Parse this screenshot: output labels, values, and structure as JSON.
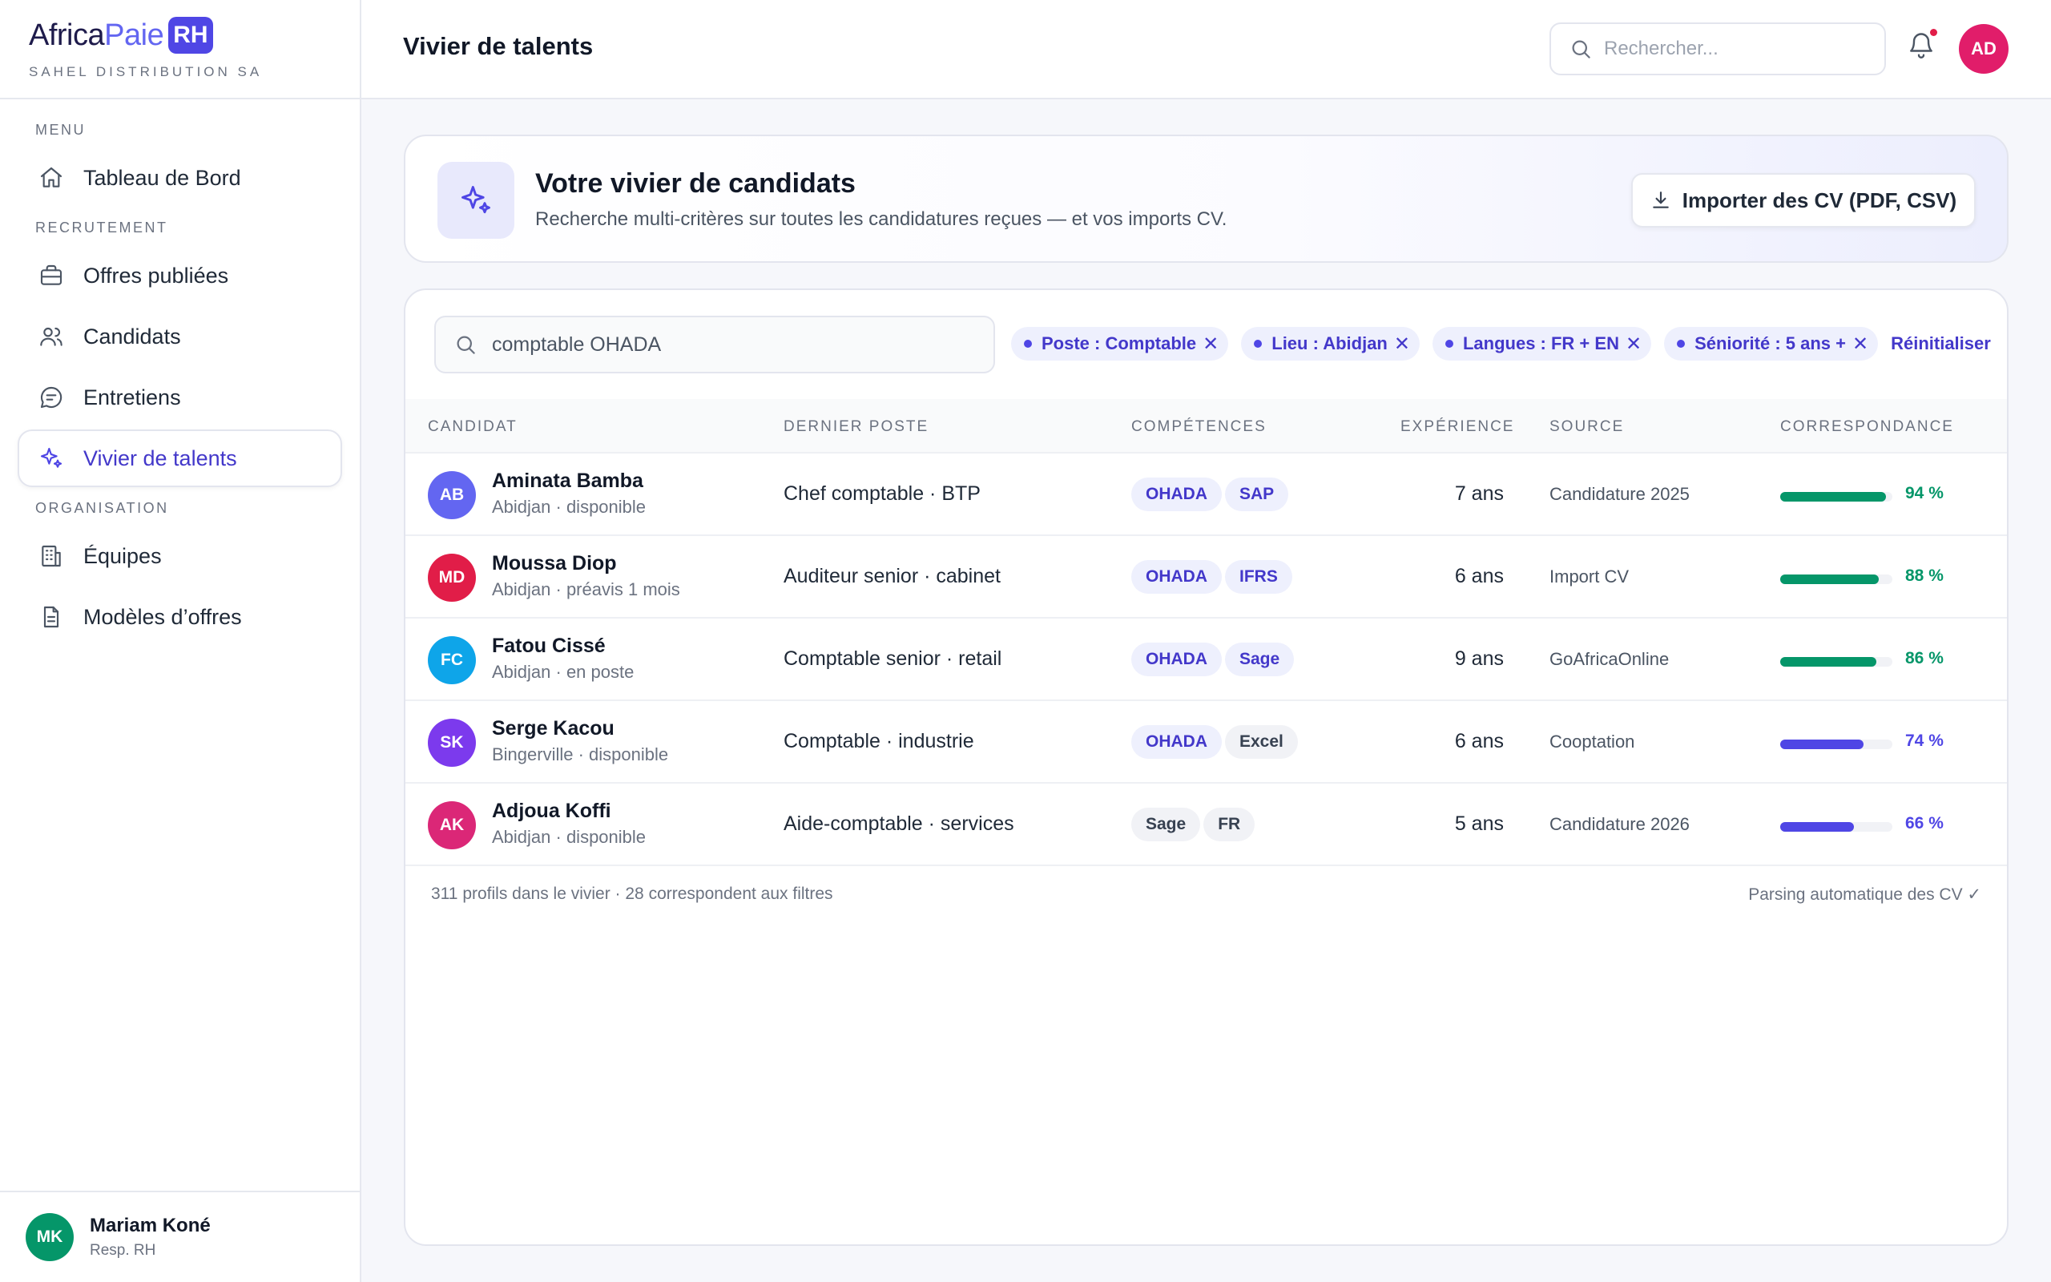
{
  "brand": {
    "logo_part1": "Africa",
    "logo_part2": "Paie",
    "logo_badge": "RH",
    "company": "SAHEL DISTRIBUTION SA"
  },
  "sidebar": {
    "sections": {
      "menu": "MENU",
      "recrutement": "RECRUTEMENT",
      "organisation": "ORGANISATION"
    },
    "items": [
      {
        "label": "Tableau de Bord",
        "icon": "home-icon"
      },
      {
        "label": "Offres publiées",
        "icon": "briefcase-icon"
      },
      {
        "label": "Candidats",
        "icon": "users-icon"
      },
      {
        "label": "Entretiens",
        "icon": "chat-icon"
      },
      {
        "label": "Vivier de talents",
        "icon": "sparkles-icon",
        "active": true
      },
      {
        "label": "Équipes",
        "icon": "building-icon"
      },
      {
        "label": "Modèles d’offres",
        "icon": "document-icon"
      }
    ],
    "user": {
      "initials": "MK",
      "name": "Mariam Koné",
      "role": "Resp. RH"
    }
  },
  "topbar": {
    "title": "Vivier de talents",
    "search_placeholder": "Rechercher...",
    "avatar_initials": "AD"
  },
  "hero": {
    "title": "Votre vivier de candidats",
    "subtitle": "Recherche multi-critères sur toutes les candidatures reçues — et vos imports CV.",
    "import_button": "Importer des CV (PDF, CSV)"
  },
  "filters": {
    "search_value": "comptable OHADA",
    "chips": [
      "Poste : Comptable",
      "Lieu : Abidjan",
      "Langues : FR + EN",
      "Séniorité : 5 ans +"
    ],
    "reset_label": "Réinitialiser"
  },
  "table": {
    "headers": {
      "candidat": "CANDIDAT",
      "poste": "DERNIER POSTE",
      "competences": "COMPÉTENCES",
      "experience": "EXPÉRIENCE",
      "source": "SOURCE",
      "correspondance": "CORRESPONDANCE"
    },
    "rows": [
      {
        "initials": "AB",
        "avatar_color": "#6366f1",
        "name": "Aminata Bamba",
        "sub": "Abidjan · disponible",
        "poste": "Chef comptable · BTP",
        "skills": [
          "OHADA",
          "SAP"
        ],
        "skill_style": [
          "hi",
          "hi"
        ],
        "experience": "7 ans",
        "source": "Candidature 2025",
        "match": 94,
        "match_label": "94 %",
        "match_color": "#059669"
      },
      {
        "initials": "MD",
        "avatar_color": "#e11d48",
        "name": "Moussa Diop",
        "sub": "Abidjan · préavis 1 mois",
        "poste": "Auditeur senior · cabinet",
        "skills": [
          "OHADA",
          "IFRS"
        ],
        "skill_style": [
          "hi",
          "hi"
        ],
        "experience": "6 ans",
        "source": "Import CV",
        "match": 88,
        "match_label": "88 %",
        "match_color": "#059669"
      },
      {
        "initials": "FC",
        "avatar_color": "#0ea5e9",
        "name": "Fatou Cissé",
        "sub": "Abidjan · en poste",
        "poste": "Comptable senior · retail",
        "skills": [
          "OHADA",
          "Sage"
        ],
        "skill_style": [
          "hi",
          "hi"
        ],
        "experience": "9 ans",
        "source": "GoAfricaOnline",
        "match": 86,
        "match_label": "86 %",
        "match_color": "#059669"
      },
      {
        "initials": "SK",
        "avatar_color": "#7c3aed",
        "name": "Serge Kacou",
        "sub": "Bingerville · disponible",
        "poste": "Comptable · industrie",
        "skills": [
          "OHADA",
          "Excel"
        ],
        "skill_style": [
          "hi",
          "lo"
        ],
        "experience": "6 ans",
        "source": "Cooptation",
        "match": 74,
        "match_label": "74 %",
        "match_color": "#4f46e5"
      },
      {
        "initials": "AK",
        "avatar_color": "#db2777",
        "name": "Adjoua Koffi",
        "sub": "Abidjan · disponible",
        "poste": "Aide-comptable · services",
        "skills": [
          "Sage",
          "FR"
        ],
        "skill_style": [
          "lo",
          "lo"
        ],
        "experience": "5 ans",
        "source": "Candidature 2026",
        "match": 66,
        "match_label": "66 %",
        "match_color": "#4f46e5"
      }
    ]
  },
  "footer": {
    "left": "311 profils dans le vivier · 28 correspondent aux filtres",
    "right": "Parsing automatique des CV ✓"
  }
}
